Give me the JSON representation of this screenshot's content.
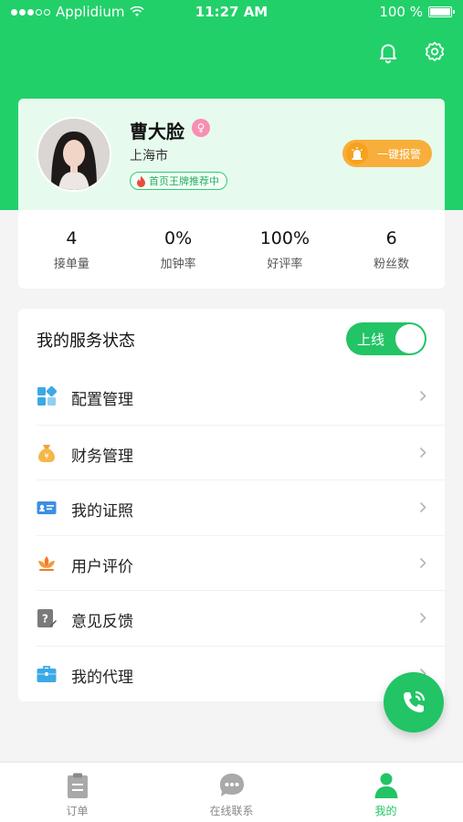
{
  "status_bar": {
    "carrier": "Applidium",
    "time": "11:27 AM",
    "battery": "100 %",
    "battery_level": 1.0
  },
  "header": {
    "icons": [
      "bell-icon",
      "gear-icon"
    ]
  },
  "profile": {
    "name": "曹大脸",
    "gender_icon": "female-icon",
    "city": "上海市",
    "badge": "首页王牌推荐中",
    "alarm_button": "一键报警"
  },
  "stats": [
    {
      "value": "4",
      "label": "接单量"
    },
    {
      "value": "0%",
      "label": "加钟率"
    },
    {
      "value": "100%",
      "label": "好评率"
    },
    {
      "value": "6",
      "label": "粉丝数"
    }
  ],
  "service": {
    "title": "我的服务状态",
    "toggle_label": "上线",
    "toggle_on": true
  },
  "menu": [
    {
      "label": "配置管理",
      "icon": "config-icon"
    },
    {
      "label": "财务管理",
      "icon": "money-bag-icon"
    },
    {
      "label": "我的证照",
      "icon": "id-card-icon"
    },
    {
      "label": "用户评价",
      "icon": "lotus-icon"
    },
    {
      "label": "意见反馈",
      "icon": "feedback-icon"
    },
    {
      "label": "我的代理",
      "icon": "briefcase-icon"
    }
  ],
  "fab": {
    "icon": "phone-icon"
  },
  "tabbar": [
    {
      "label": "订单",
      "icon": "clipboard-icon",
      "active": false
    },
    {
      "label": "在线联系",
      "icon": "chat-icon",
      "active": false
    },
    {
      "label": "我的",
      "icon": "person-icon",
      "active": true
    }
  ],
  "colors": {
    "primary": "#22c465",
    "hero": "#22d06a",
    "alarm": "#f8ae3a",
    "profile_bg": "#e6fbee"
  }
}
